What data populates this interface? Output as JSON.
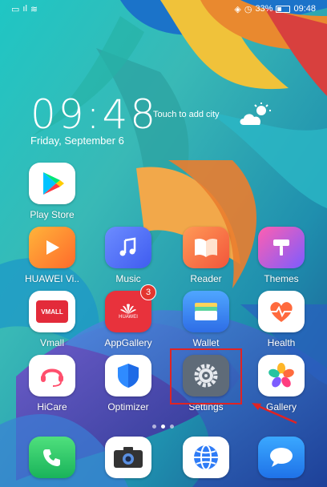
{
  "status_bar": {
    "left_icons": [
      "sim-icon",
      "signal-icon",
      "wifi-icon"
    ],
    "right_icons": [
      "vibrate-icon",
      "alarm-icon"
    ],
    "battery": "33%",
    "time": "09:48"
  },
  "lock_clock": {
    "time": "09:48",
    "weather_hint": "Touch to add city",
    "date": "Friday, September 6"
  },
  "apps": {
    "play_store": "Play Store",
    "huawei_video": "HUAWEI Vi..",
    "music": "Music",
    "reader": "Reader",
    "themes": "Themes",
    "vmall": "Vmall",
    "appgallery": "AppGallery",
    "appgallery_badge": "3",
    "wallet": "Wallet",
    "health": "Health",
    "hicare": "HiCare",
    "optimizer": "Optimizer",
    "settings": "Settings",
    "gallery": "Gallery"
  },
  "icon_text": {
    "vmall": "VMALL",
    "huawei": "HUAWEI"
  },
  "dock": [
    "phone-icon",
    "camera-icon",
    "browser-icon",
    "messages-icon"
  ],
  "page_indicator": {
    "pages": 3,
    "current": 2
  },
  "colors": {
    "highlight": "#e02323",
    "badge": "#e3362f"
  }
}
